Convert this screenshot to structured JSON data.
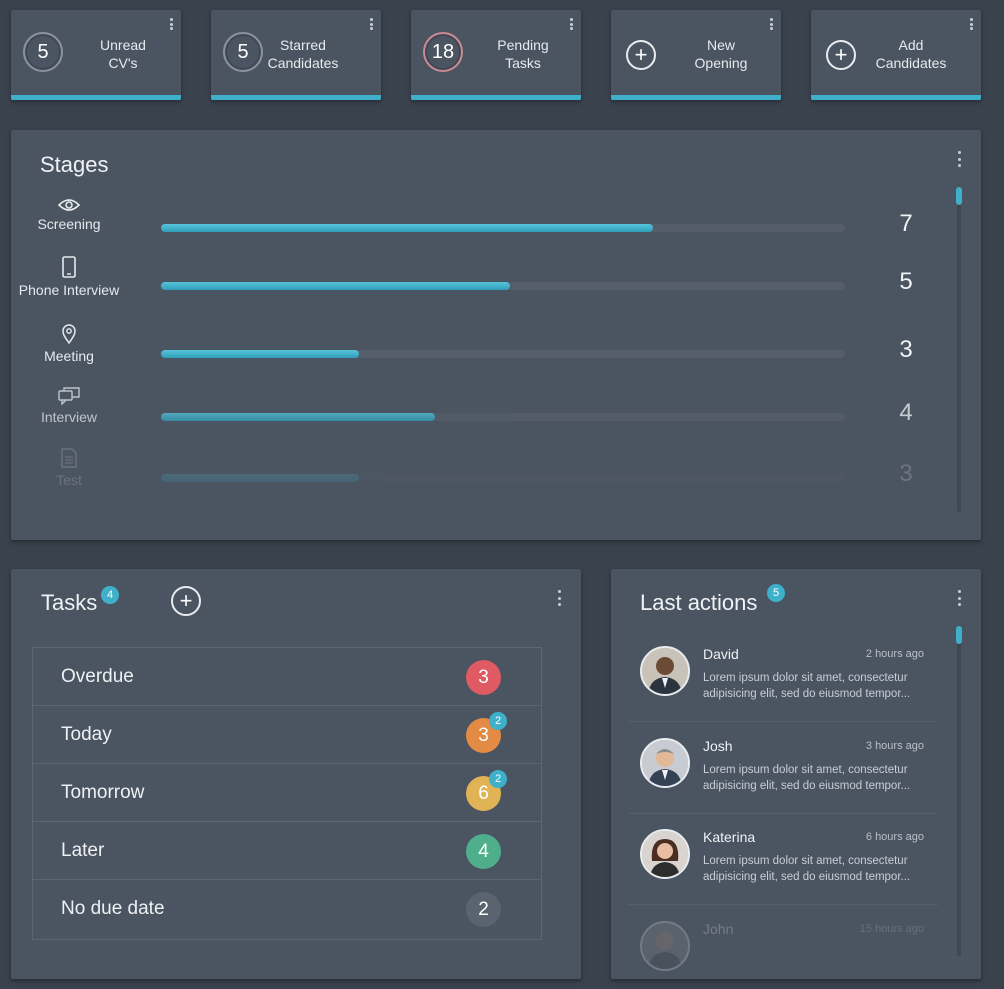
{
  "stats": [
    {
      "value": "5",
      "label": "Unread CV's",
      "kind": "number",
      "ring": "#8b949e"
    },
    {
      "value": "5",
      "label": "Starred Candidates",
      "kind": "number",
      "ring": "#8b949e"
    },
    {
      "value": "18",
      "label": "Pending Tasks",
      "kind": "number",
      "ring": "#c98a95"
    },
    {
      "value": "+",
      "label": "New Opening",
      "kind": "plus"
    },
    {
      "value": "+",
      "label": "Add Candidates",
      "kind": "plus"
    }
  ],
  "stages": {
    "title": "Stages",
    "accent": "#3fb0c9",
    "rows": [
      {
        "name": "Screening",
        "icon": "eye-icon",
        "count": "7",
        "fill": 0.72
      },
      {
        "name": "Phone Interview",
        "icon": "phone-icon",
        "count": "5",
        "fill": 0.51
      },
      {
        "name": "Meeting",
        "icon": "location-pin-icon",
        "count": "3",
        "fill": 0.29
      },
      {
        "name": "Interview",
        "icon": "chat-icon",
        "count": "4",
        "fill": 0.4
      },
      {
        "name": "Test",
        "icon": "document-icon",
        "count": "3",
        "fill": 0.29
      }
    ]
  },
  "tasks": {
    "title": "Tasks",
    "badge": "4",
    "rows": [
      {
        "label": "Overdue",
        "count": "3",
        "color": "#e05a63",
        "badge": ""
      },
      {
        "label": "Today",
        "count": "3",
        "color": "#e38a45",
        "badge": "2"
      },
      {
        "label": "Tomorrow",
        "count": "6",
        "color": "#e0b455",
        "badge": "2"
      },
      {
        "label": "Later",
        "count": "4",
        "color": "#4fae8c",
        "badge": ""
      },
      {
        "label": "No due date",
        "count": "2",
        "color": "#5a6370",
        "badge": ""
      }
    ]
  },
  "last_actions": {
    "title": "Last actions",
    "badge": "5",
    "items": [
      {
        "name": "David",
        "time": "2 hours ago",
        "text": "Lorem ipsum dolor sit amet, consectetur adipisicing elit, sed do eiusmod tempor..."
      },
      {
        "name": "Josh",
        "time": "3 hours ago",
        "text": "Lorem ipsum dolor sit amet, consectetur adipisicing elit, sed do eiusmod tempor..."
      },
      {
        "name": "Katerina",
        "time": "6 hours ago",
        "text": "Lorem ipsum dolor sit amet, consectetur adipisicing elit, sed do eiusmod tempor..."
      },
      {
        "name": "John",
        "time": "15 hours ago",
        "text": ""
      }
    ]
  }
}
